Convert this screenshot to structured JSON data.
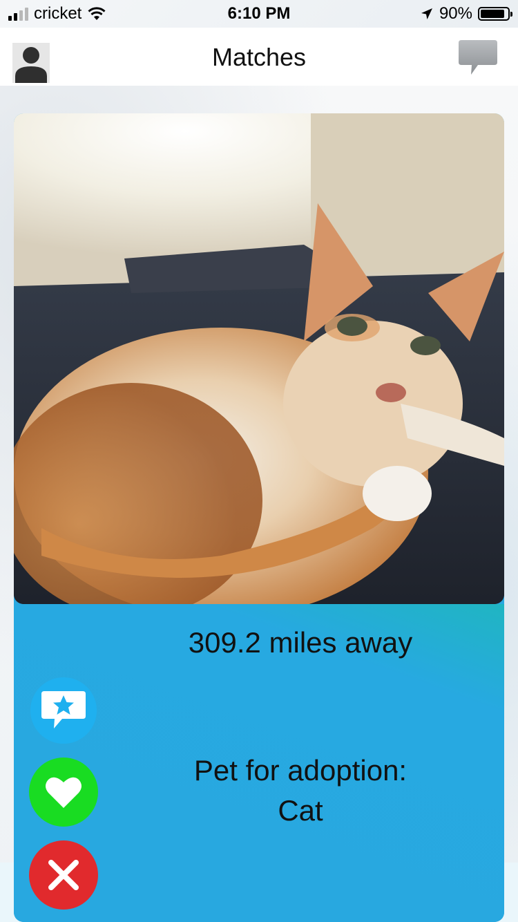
{
  "status_bar": {
    "carrier": "cricket",
    "time": "6:10 PM",
    "battery_text": "90%",
    "battery_level": 0.9
  },
  "nav": {
    "title": "Matches",
    "left_icon": "person-icon",
    "right_icon": "chat-bubble-icon"
  },
  "match_card": {
    "photo_subject": "orange-white-cat-photo",
    "distance": "309.2 miles away",
    "adoption_label": "Pet for adoption:",
    "pet_type": "Cat",
    "actions": {
      "super_like_icon": "star-chat-icon",
      "like_icon": "heart-icon",
      "dislike_icon": "close-icon"
    }
  },
  "colors": {
    "panel_blue": "#28a8e0",
    "super_like": "#1fb0ef",
    "like": "#19dc22",
    "dislike": "#e12a2d"
  }
}
